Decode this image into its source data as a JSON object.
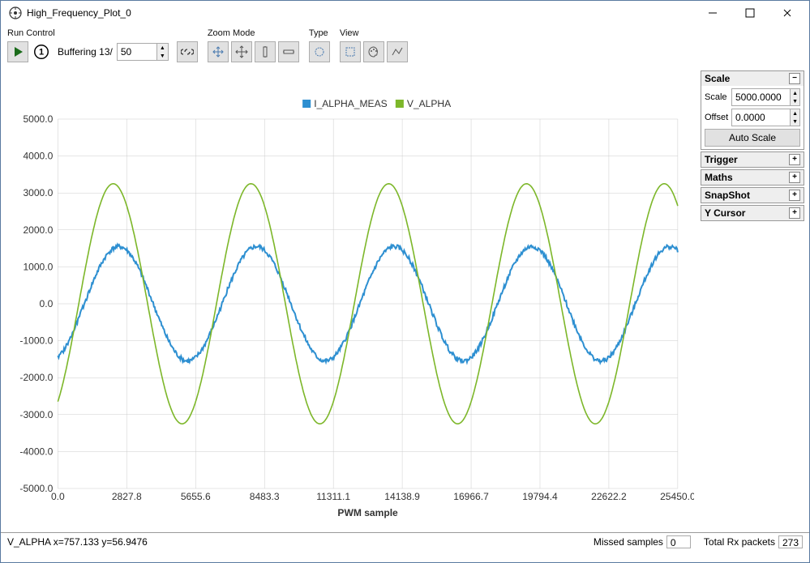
{
  "window": {
    "title": "High_Frequency_Plot_0"
  },
  "toolbar": {
    "run_control": {
      "label": "Run Control",
      "buffering_label": "Buffering 13/",
      "buffer_size": "50"
    },
    "zoom_mode": {
      "label": "Zoom Mode"
    },
    "type": {
      "label": "Type"
    },
    "view": {
      "label": "View"
    }
  },
  "side": {
    "scale": {
      "header": "Scale",
      "scale_label": "Scale",
      "scale_value": "5000.0000",
      "offset_label": "Offset",
      "offset_value": "0.0000",
      "auto_scale": "Auto Scale"
    },
    "trigger": {
      "header": "Trigger"
    },
    "maths": {
      "header": "Maths"
    },
    "snapshot": {
      "header": "SnapShot"
    },
    "ycursor": {
      "header": "Y Cursor"
    }
  },
  "status": {
    "cursor": "V_ALPHA x=757.133 y=56.9476",
    "missed_label": "Missed samples",
    "missed_value": "0",
    "rx_label": "Total Rx packets",
    "rx_value": "273"
  },
  "chart_data": {
    "type": "line",
    "xlabel": "PWM sample",
    "ylabel": "",
    "xlim": [
      0,
      25450
    ],
    "ylim": [
      -5000,
      5000
    ],
    "x_ticks": [
      0.0,
      2827.8,
      5655.6,
      8483.3,
      11311.1,
      14138.9,
      16966.7,
      19794.4,
      22622.2,
      25450.0
    ],
    "y_ticks": [
      -5000.0,
      -4000.0,
      -3000.0,
      -2000.0,
      -1000.0,
      0.0,
      1000.0,
      2000.0,
      3000.0,
      4000.0,
      5000.0
    ],
    "legend": [
      "I_ALPHA_MEAS",
      "V_ALPHA"
    ],
    "series": [
      {
        "name": "I_ALPHA_MEAS",
        "color": "#2d8fd1",
        "amplitude": 1550,
        "periods": 4.5,
        "phase_samples": 1000,
        "offset": 0,
        "y_at_x0": -1450,
        "noisy": true
      },
      {
        "name": "V_ALPHA",
        "color": "#7db72a",
        "amplitude": 3250,
        "periods": 4.5,
        "phase_samples": 1000,
        "offset": 0,
        "y_at_x0": -2650,
        "noisy": false
      }
    ]
  }
}
